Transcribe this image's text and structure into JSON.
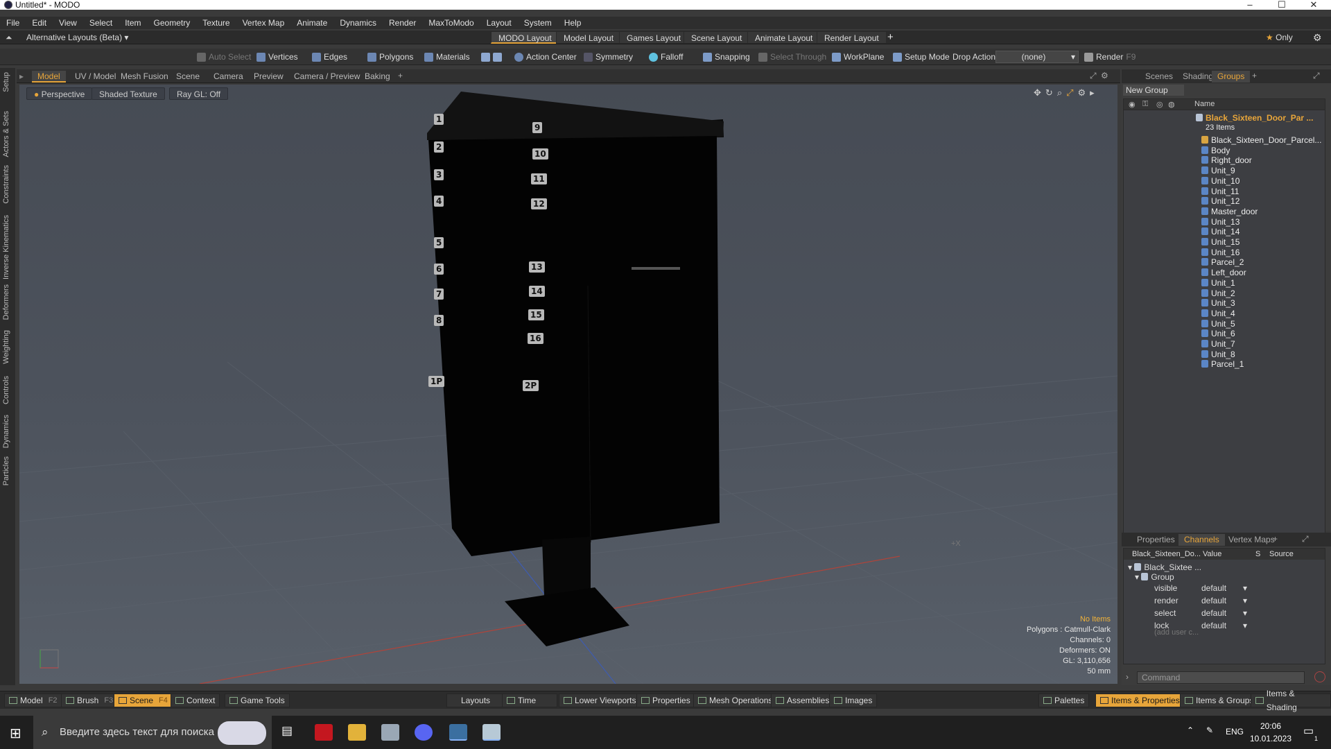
{
  "window": {
    "title": "Untitled* - MODO",
    "controls": [
      "–",
      "☐",
      "✕"
    ]
  },
  "menu": [
    "File",
    "Edit",
    "View",
    "Select",
    "Item",
    "Geometry",
    "Texture",
    "Vertex Map",
    "Animate",
    "Dynamics",
    "Render",
    "MaxToModo",
    "Layout",
    "System",
    "Help"
  ],
  "layout": {
    "alt": "Alternative Layouts (Beta)",
    "tabs": [
      "MODO Layout",
      "Model Layout",
      "Games Layout",
      "Scene Layout",
      "Animate Layout",
      "Render Layout"
    ],
    "add": "+",
    "only": "Only"
  },
  "toolbar": {
    "auto_select": "Auto Select",
    "vertices": "Vertices",
    "edges": "Edges",
    "polygons": "Polygons",
    "materials": "Materials",
    "action_center": "Action Center",
    "symmetry": "Symmetry",
    "falloff": "Falloff",
    "snapping": "Snapping",
    "select_through": "Select Through",
    "workplane": "WorkPlane",
    "setup_mode": "Setup Mode",
    "drop_action": "Drop Action",
    "drop_value": "(none)",
    "render": "Render",
    "render_key": "F9"
  },
  "left_tabs": [
    "Setup",
    "Actors & Sets",
    "Constraints",
    "Inverse Kinematics",
    "Deformers",
    "Weighting",
    "Controls",
    "Dynamics",
    "Particles"
  ],
  "viewport_tabs": [
    "Model",
    "UV / Model",
    "Mesh Fusion",
    "Scene",
    "Camera",
    "Preview",
    "Camera / Preview",
    "Baking"
  ],
  "viewport": {
    "perspective": "Perspective",
    "shading": "Shaded Texture",
    "raygl": "Ray GL: Off",
    "mailbox_numbers": [
      "1",
      "2",
      "3",
      "4",
      "5",
      "6",
      "7",
      "8",
      "9",
      "10",
      "11",
      "12",
      "13",
      "14",
      "15",
      "16",
      "1P",
      "2P"
    ],
    "axis_label": "+X",
    "status": {
      "items": "No Items",
      "polygons": "Polygons : Catmull-Clark",
      "channels": "Channels: 0",
      "deformers": "Deformers: ON",
      "gl": "GL: 3,110,656",
      "scale": "50 mm"
    }
  },
  "scene_tabs": [
    "Scenes",
    "Shading",
    "Groups"
  ],
  "groups": {
    "new_group": "New Group",
    "column_name": "Name",
    "root": "Black_Sixteen_Door_Par ...",
    "count": "23 Items",
    "items": [
      "Black_Sixteen_Door_Parcel...",
      "Body",
      "Right_door",
      "Unit_9",
      "Unit_10",
      "Unit_11",
      "Unit_12",
      "Master_door",
      "Unit_13",
      "Unit_14",
      "Unit_15",
      "Unit_16",
      "Parcel_2",
      "Left_door",
      "Unit_1",
      "Unit_2",
      "Unit_3",
      "Unit_4",
      "Unit_5",
      "Unit_6",
      "Unit_7",
      "Unit_8",
      "Parcel_1"
    ]
  },
  "prop_tabs": [
    "Properties",
    "Channels",
    "Vertex Maps"
  ],
  "channels": {
    "headers": [
      "Black_Sixteen_Do...",
      "Value",
      "S",
      "Source"
    ],
    "root": "Black_Sixtee ...",
    "group": "Group",
    "rows": [
      {
        "name": "visible",
        "value": "default"
      },
      {
        "name": "render",
        "value": "default"
      },
      {
        "name": "select",
        "value": "default"
      },
      {
        "name": "lock",
        "value": "default"
      }
    ],
    "add_user": "(add user c...",
    "command_placeholder": "Command"
  },
  "bottom": {
    "model": "Model",
    "model_key": "F2",
    "brush": "Brush",
    "brush_key": "F3",
    "scene": "Scene",
    "scene_key": "F4",
    "context": "Context",
    "game_tools": "Game Tools",
    "layouts": "Layouts",
    "time": "Time",
    "lower_viewports": "Lower Viewports",
    "properties": "Properties",
    "mesh_operations": "Mesh Operations",
    "assemblies": "Assemblies",
    "images": "Images",
    "palettes": "Palettes",
    "items_properties": "Items & Properties",
    "items_groups": "Items & Groups",
    "items_shading": "Items & Shading"
  },
  "taskbar": {
    "search": "Введите здесь текст для поиска",
    "lang": "ENG",
    "time": "20:06",
    "date": "10.01.2023",
    "notif": "1"
  },
  "colors": {
    "accent": "#e7a53a",
    "viewport_bg": "#4d535d",
    "panel": "#3c3c3c"
  }
}
